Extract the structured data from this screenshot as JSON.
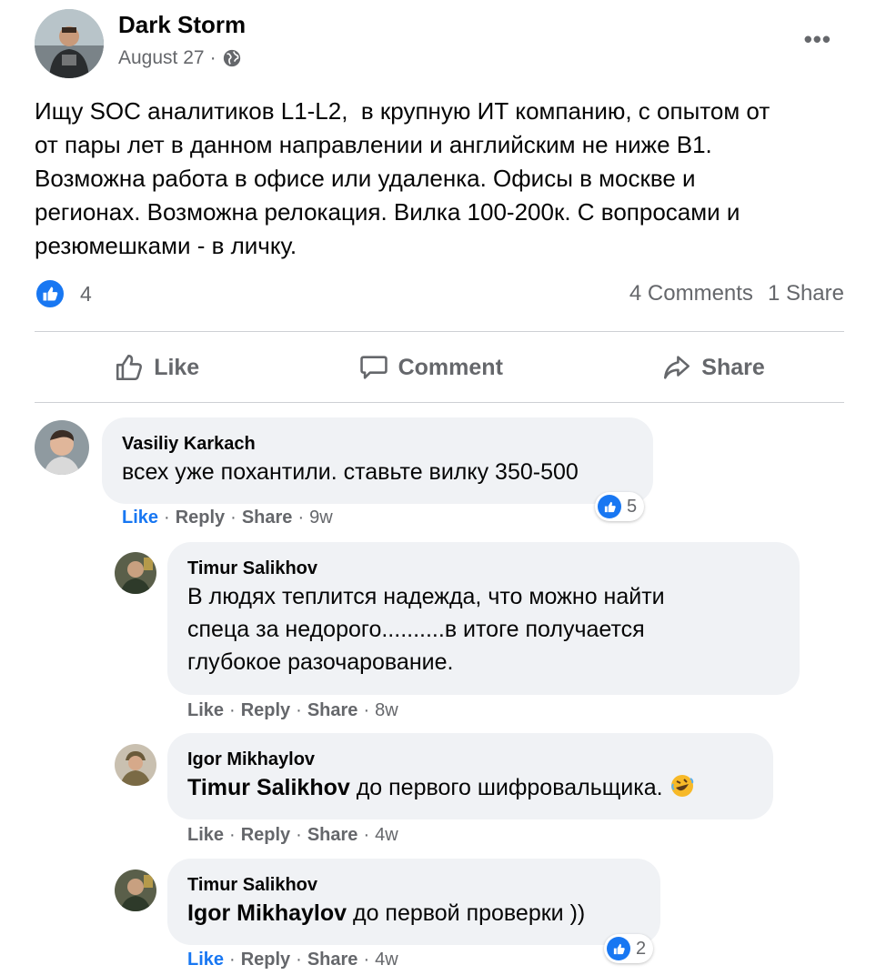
{
  "post": {
    "author": "Dark Storm",
    "date": "August 27",
    "date_sep": "·",
    "more": "•••",
    "text": "Ищу SOC аналитиков L1-L2,  в крупную ИТ компанию, с опытом от\nот пары лет в данном направлении и английским не ниже B1.\nВозможна работа в офисе или удаленка. Офисы в москве и\nрегионах. Возможна релокация. Вилка 100-200к. С вопросами и\nрезюмешками - в личку.",
    "reactions_count": "4",
    "comments_count": "4 Comments",
    "shares_count": "1 Share"
  },
  "actions": {
    "like": "Like",
    "comment": "Comment",
    "share": "Share"
  },
  "comments": [
    {
      "name": "Vasiliy Karkach",
      "text": "всех уже похантили. ставьте вилку 350-500",
      "like": "Like",
      "reply": "Reply",
      "share": "Share",
      "time": "9w",
      "reactions": "5"
    },
    {
      "name": "Timur Salikhov",
      "text": "В людях теплится надежда, что можно найти\nспеца за недорого..........в итоге получается\nглубокое разочарование.",
      "like": "Like",
      "reply": "Reply",
      "share": "Share",
      "time": "8w"
    },
    {
      "name": "Igor Mikhaylov",
      "mention": "Timur Salikhov",
      "text": " до первого шифровальщика. ",
      "emoji": "rolling-on-floor-laughing-emoji",
      "like": "Like",
      "reply": "Reply",
      "share": "Share",
      "time": "4w"
    },
    {
      "name": "Timur Salikhov",
      "mention": "Igor Mikhaylov",
      "text": " до первой проверки ))",
      "like": "Like",
      "reply": "Reply",
      "share": "Share",
      "time": "4w",
      "reactions": "2"
    }
  ],
  "colors": {
    "accent": "#1877f2",
    "secondary_text": "#65676b",
    "bubble": "#f0f2f5"
  },
  "separator": "·"
}
